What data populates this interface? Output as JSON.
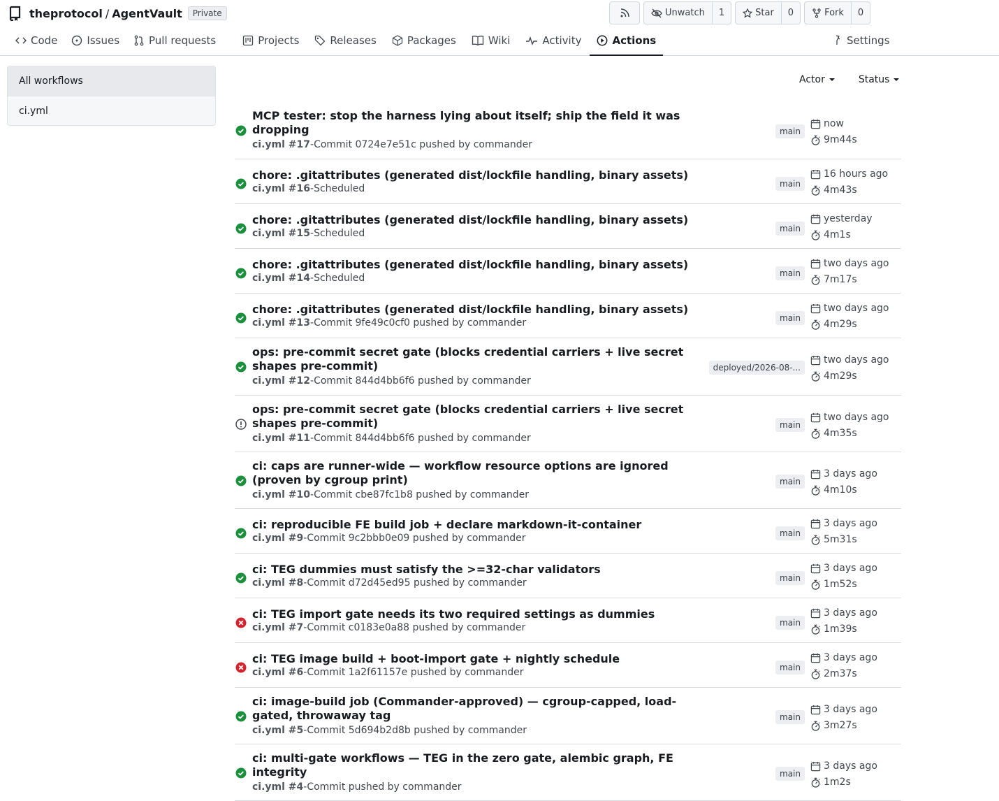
{
  "repo": {
    "owner": "theprotocol",
    "separator": "/",
    "name": "AgentVault",
    "visibility": "Private"
  },
  "header_actions": {
    "rss_icon": "rss-icon",
    "unwatch_label": "Unwatch",
    "watch_count": "1",
    "star_label": "Star",
    "star_count": "0",
    "fork_label": "Fork",
    "fork_count": "0"
  },
  "tabs": [
    {
      "label": "Code",
      "icon": "code-icon"
    },
    {
      "label": "Issues",
      "icon": "issue-icon"
    },
    {
      "label": "Pull requests",
      "icon": "pull-request-icon"
    },
    {
      "label": "Projects",
      "icon": "project-icon"
    },
    {
      "label": "Releases",
      "icon": "tag-icon"
    },
    {
      "label": "Packages",
      "icon": "package-icon"
    },
    {
      "label": "Wiki",
      "icon": "book-icon"
    },
    {
      "label": "Activity",
      "icon": "pulse-icon"
    },
    {
      "label": "Actions",
      "icon": "play-icon",
      "active": true
    }
  ],
  "settings_label": "Settings",
  "sidebar": {
    "items": [
      {
        "label": "All workflows",
        "active": true
      },
      {
        "label": "ci.yml"
      }
    ]
  },
  "filters": {
    "actor": "Actor",
    "status": "Status"
  },
  "runs": [
    {
      "title": "MCP tester: stop the harness lying about itself; ship the field it was dropping",
      "workflow": "ci.yml #17",
      "trigger": "-Commit 0724e7e51c pushed by commander",
      "branch": "main",
      "when": "now",
      "duration": "9m44s",
      "status": "success"
    },
    {
      "title": "chore: .gitattributes (generated dist/lockfile handling, binary assets)",
      "workflow": "ci.yml #16",
      "trigger": "-Scheduled",
      "branch": "main",
      "when": "16 hours ago",
      "duration": "4m43s",
      "status": "success"
    },
    {
      "title": "chore: .gitattributes (generated dist/lockfile handling, binary assets)",
      "workflow": "ci.yml #15",
      "trigger": "-Scheduled",
      "branch": "main",
      "when": "yesterday",
      "duration": "4m1s",
      "status": "success"
    },
    {
      "title": "chore: .gitattributes (generated dist/lockfile handling, binary assets)",
      "workflow": "ci.yml #14",
      "trigger": "-Scheduled",
      "branch": "main",
      "when": "two days ago",
      "duration": "7m17s",
      "status": "success"
    },
    {
      "title": "chore: .gitattributes (generated dist/lockfile handling, binary assets)",
      "workflow": "ci.yml #13",
      "trigger": "-Commit 9fe49c0cf0 pushed by commander",
      "branch": "main",
      "when": "two days ago",
      "duration": "4m29s",
      "status": "success"
    },
    {
      "title": "ops: pre-commit secret gate (blocks credential carriers + live secret shapes pre-commit)",
      "workflow": "ci.yml #12",
      "trigger": "-Commit 844d4bb6f6 pushed by commander",
      "branch": "deployed/2026-08-...",
      "when": "two days ago",
      "duration": "4m29s",
      "status": "success"
    },
    {
      "title": "ops: pre-commit secret gate (blocks credential carriers + live secret shapes pre-commit)",
      "workflow": "ci.yml #11",
      "trigger": "-Commit 844d4bb6f6 pushed by commander",
      "branch": "main",
      "when": "two days ago",
      "duration": "4m35s",
      "status": "warning"
    },
    {
      "title": "ci: caps are runner-wide — workflow resource options are ignored (proven by cgroup print)",
      "workflow": "ci.yml #10",
      "trigger": "-Commit cbe87fc1b8 pushed by commander",
      "branch": "main",
      "when": "3 days ago",
      "duration": "4m10s",
      "status": "success"
    },
    {
      "title": "ci: reproducible FE build job + declare markdown-it-container",
      "workflow": "ci.yml #9",
      "trigger": "-Commit 9c2bbb0e09 pushed by commander",
      "branch": "main",
      "when": "3 days ago",
      "duration": "5m31s",
      "status": "success"
    },
    {
      "title": "ci: TEG dummies must satisfy the >=32-char validators",
      "workflow": "ci.yml #8",
      "trigger": "-Commit d72d45ed95 pushed by commander",
      "branch": "main",
      "when": "3 days ago",
      "duration": "1m52s",
      "status": "success"
    },
    {
      "title": "ci: TEG import gate needs its two required settings as dummies",
      "workflow": "ci.yml #7",
      "trigger": "-Commit c0183e0a88 pushed by commander",
      "branch": "main",
      "when": "3 days ago",
      "duration": "1m39s",
      "status": "failure"
    },
    {
      "title": "ci: TEG image build + boot-import gate + nightly schedule",
      "workflow": "ci.yml #6",
      "trigger": "-Commit 1a2f61157e pushed by commander",
      "branch": "main",
      "when": "3 days ago",
      "duration": "2m37s",
      "status": "failure"
    },
    {
      "title": "ci: image-build job (Commander-approved) — cgroup-capped, load-gated, throwaway tag",
      "workflow": "ci.yml #5",
      "trigger": "-Commit 5d694b2d8b pushed by commander",
      "branch": "main",
      "when": "3 days ago",
      "duration": "3m27s",
      "status": "success"
    },
    {
      "title": "ci: multi-gate workflows — TEG in the zero gate, alembic graph, FE integrity",
      "workflow": "ci.yml #4",
      "trigger": "-Commit pushed by commander",
      "branch": "main",
      "when": "3 days ago",
      "duration": "1m2s",
      "status": "success"
    }
  ],
  "colors": {
    "success": "#1a8f3c",
    "failure": "#d1242f",
    "warning": "#3b4047",
    "accent": "#181c21"
  }
}
